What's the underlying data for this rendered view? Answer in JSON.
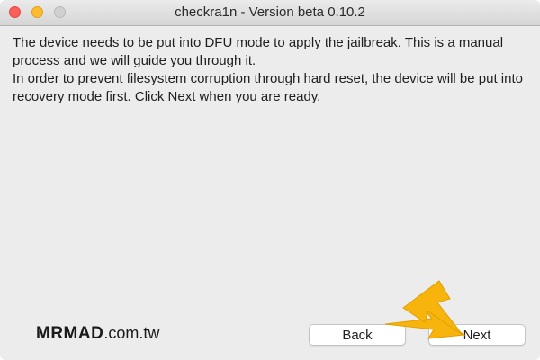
{
  "window": {
    "title": "checkra1n - Version beta 0.10.2"
  },
  "message": {
    "line1": "The device needs to be put into DFU mode to apply the jailbreak. This is a manual process and we will guide you through it.",
    "line2": "In order to prevent filesystem corruption through hard reset, the device will be put into recovery mode first. Click Next when you are ready."
  },
  "watermark": {
    "strong": "MRMAD",
    "thin": ".com.tw"
  },
  "buttons": {
    "back": "Back",
    "next": "Next"
  },
  "colors": {
    "arrow": "#f6b40c",
    "close": "#fc5f57",
    "minimize": "#fdbc2e"
  }
}
